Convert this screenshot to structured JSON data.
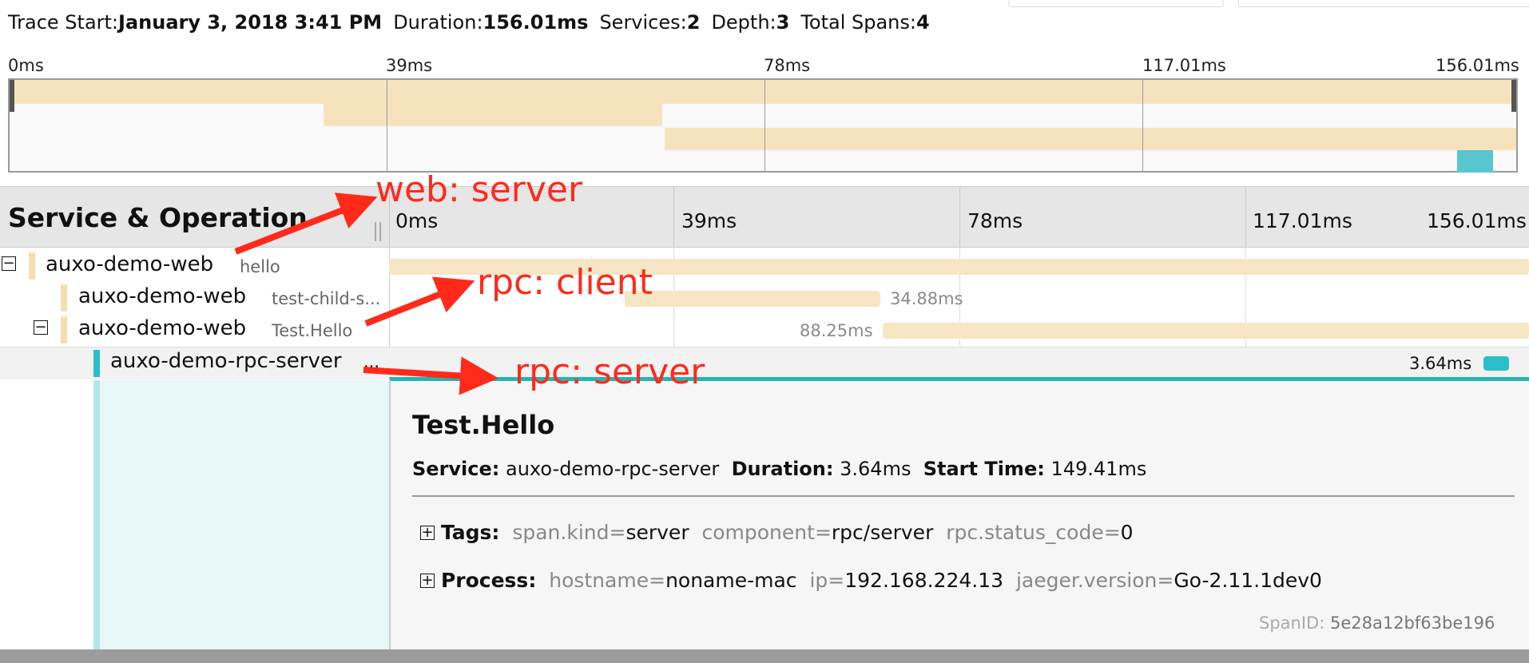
{
  "header": {
    "trace_start_label": "Trace Start:",
    "trace_start": "January 3, 2018 3:41 PM",
    "duration_label": "Duration:",
    "duration": "156.01ms",
    "services_label": "Services:",
    "services": "2",
    "depth_label": "Depth:",
    "depth": "3",
    "total_spans_label": "Total Spans:",
    "total_spans": "4"
  },
  "minimap": {
    "ticks": [
      "0ms",
      "39ms",
      "78ms",
      "117.01ms",
      "156.01ms"
    ]
  },
  "columns": {
    "title": "Service & Operation",
    "ticks": [
      "0ms",
      "39ms",
      "78ms",
      "117.01ms",
      "156.01ms"
    ]
  },
  "spans": [
    {
      "service": "auxo-demo-web",
      "operation": "hello",
      "duration": "",
      "collapsible": true,
      "toggle": "−"
    },
    {
      "service": "auxo-demo-web",
      "operation": "test-child-s...",
      "duration": "34.88ms",
      "collapsible": false
    },
    {
      "service": "auxo-demo-web",
      "operation": "Test.Hello",
      "duration": "88.25ms",
      "collapsible": true,
      "toggle": "−"
    },
    {
      "service": "auxo-demo-rpc-server",
      "operation": "...",
      "duration": "3.64ms",
      "collapsible": false
    }
  ],
  "detail": {
    "title": "Test.Hello",
    "service_label": "Service:",
    "service": "auxo-demo-rpc-server",
    "duration_label": "Duration:",
    "duration": "3.64ms",
    "start_label": "Start Time:",
    "start": "149.41ms",
    "tags_label": "Tags:",
    "tags": [
      {
        "key": "span.kind",
        "value": "server"
      },
      {
        "key": "component",
        "value": "rpc/server"
      },
      {
        "key": "rpc.status_code",
        "value": "0"
      }
    ],
    "process_label": "Process:",
    "process": [
      {
        "key": "hostname",
        "value": "noname-mac"
      },
      {
        "key": "ip",
        "value": "192.168.224.13"
      },
      {
        "key": "jaeger.version",
        "value": "Go-2.11.1dev0"
      }
    ],
    "span_id_label": "SpanID:",
    "span_id": "5e28a12bf63be196",
    "expand_symbol": "+"
  },
  "annotations": {
    "web_server": "web: server",
    "rpc_client": "rpc: client",
    "rpc_server": "rpc: server"
  },
  "colors": {
    "span_web": "#f5deb3",
    "span_rpc": "#2bbfc9",
    "annotation": "#ff2a1a"
  }
}
